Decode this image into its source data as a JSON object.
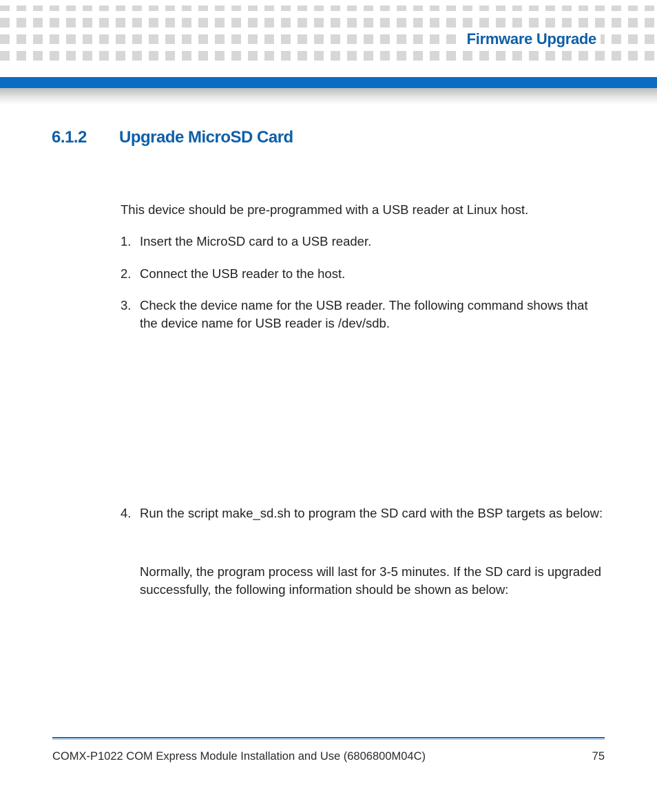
{
  "header": {
    "running_title": "Firmware Upgrade"
  },
  "section": {
    "number": "6.1.2",
    "title": "Upgrade MicroSD Card",
    "intro": "This device should be pre-programmed with a USB reader at Linux host.",
    "steps": {
      "s1": "Insert the MicroSD card to a USB reader.",
      "s2": "Connect the USB reader to the host.",
      "s3": "Check the device name for the USB reader. The following command shows that the device name for USB reader is /dev/sdb.",
      "s4": "Run the script make_sd.sh to program the SD card with the BSP targets as below:",
      "s4_after": "Normally, the program process will last for 3-5 minutes. If the SD card is upgraded successfully, the following information should be shown as below:"
    }
  },
  "footer": {
    "doc_title": "COMX-P1022 COM Express Module Installation and Use (6806800M04C)",
    "page_number": "75"
  }
}
